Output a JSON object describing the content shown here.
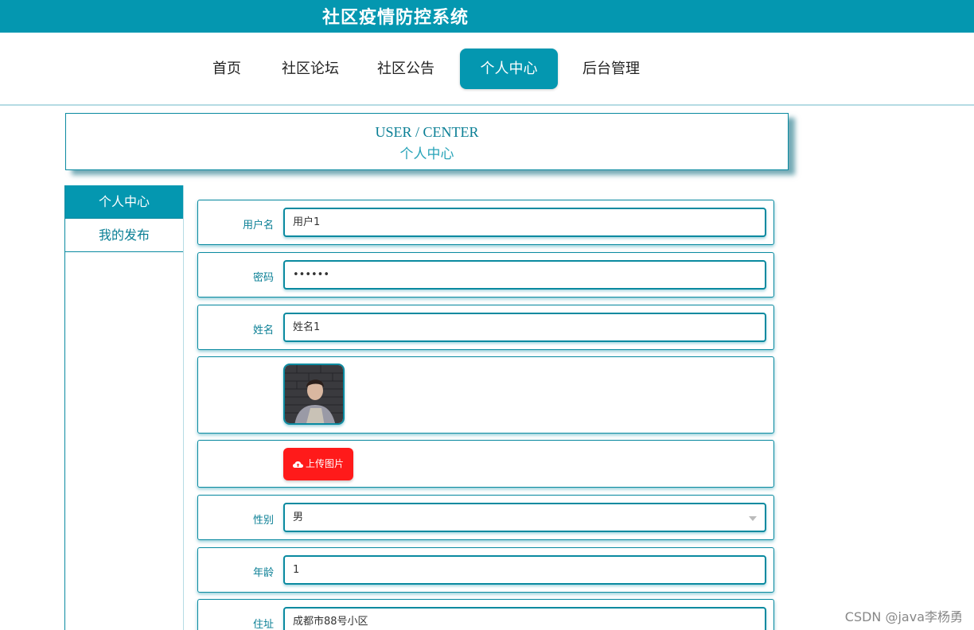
{
  "header": {
    "title": "社区疫情防控系统"
  },
  "nav": {
    "items": [
      {
        "label": "首页"
      },
      {
        "label": "社区论坛"
      },
      {
        "label": "社区公告"
      },
      {
        "label": "个人中心"
      },
      {
        "label": "后台管理"
      }
    ],
    "active": "个人中心"
  },
  "page_heading": {
    "english": "USER / CENTER",
    "chinese": "个人中心"
  },
  "sidebar": {
    "items": [
      {
        "label": "个人中心"
      },
      {
        "label": "我的发布"
      }
    ]
  },
  "form": {
    "username": {
      "label": "用户名",
      "value": "用户1"
    },
    "password": {
      "label": "密码",
      "value": "••••••"
    },
    "name": {
      "label": "姓名",
      "value": "姓名1"
    },
    "upload": {
      "label": "上传图片",
      "icon": "cloud-upload-icon"
    },
    "gender": {
      "label": "性别",
      "value": "男"
    },
    "age": {
      "label": "年龄",
      "value": "1"
    },
    "address": {
      "label": "住址",
      "value": "成都市88号小区"
    }
  },
  "watermark": "CSDN @java李杨勇",
  "colors": {
    "primary": "#0497b0",
    "upload_button": "#ff1a1a"
  }
}
